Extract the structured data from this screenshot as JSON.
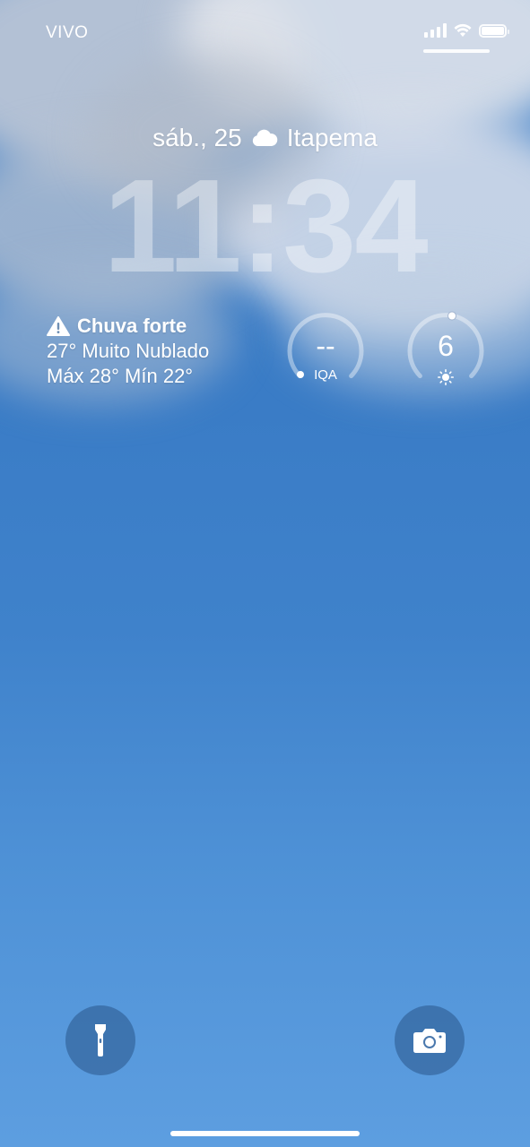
{
  "status_bar": {
    "carrier": "VIVO",
    "icons": [
      "cellular-signal-icon",
      "wifi-icon",
      "battery-icon"
    ]
  },
  "lock_screen": {
    "date": "sáb., 25",
    "location": "Itapema",
    "location_icon": "cloud-icon",
    "time": "11:34"
  },
  "weather_widget": {
    "alert": "Chuva forte",
    "alert_icon": "warning-icon",
    "current": "27° Muito Nublado",
    "range": "Máx 28° Mín 22°"
  },
  "aqi_widget": {
    "value": "--",
    "label": "IQA",
    "level": 0
  },
  "uv_widget": {
    "value": "6",
    "icon": "sun-icon",
    "level": 0.5
  },
  "bottom_controls": {
    "left": "flashlight-icon",
    "right": "camera-icon"
  },
  "colors": {
    "sky_top": "#3d7fc8",
    "sky_bottom": "#5d9ee0"
  }
}
